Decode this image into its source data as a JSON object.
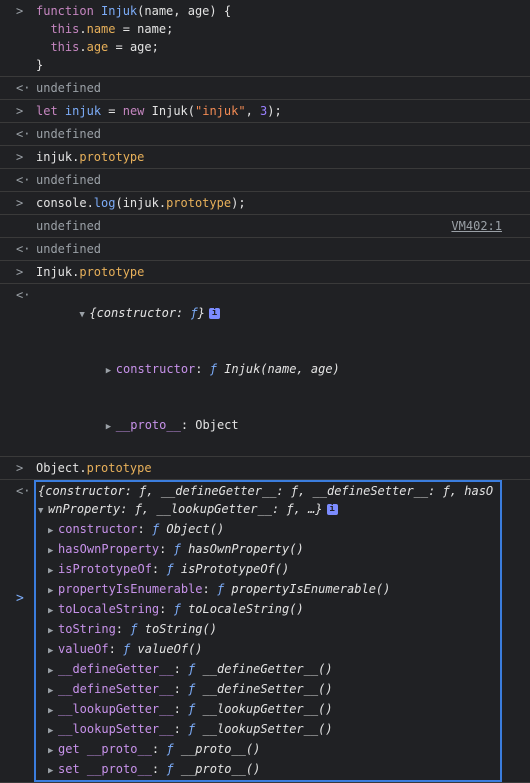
{
  "entries": [
    {
      "kind": "input",
      "lines": [
        "function Injuk(name, age) {",
        "  this.name = name;",
        "  this.age = age;",
        "}"
      ]
    },
    {
      "kind": "result",
      "text": "undefined"
    },
    {
      "kind": "input",
      "text": "let injuk = new Injuk(\"injuk\", 3);"
    },
    {
      "kind": "result",
      "text": "undefined"
    },
    {
      "kind": "input",
      "text": "injuk.prototype"
    },
    {
      "kind": "result",
      "text": "undefined"
    },
    {
      "kind": "input",
      "text": "console.log(injuk.prototype);"
    },
    {
      "kind": "log",
      "text": "undefined",
      "link": "VM402:1"
    },
    {
      "kind": "result",
      "text": "undefined"
    },
    {
      "kind": "input",
      "text": "Injuk.prototype"
    }
  ],
  "injuk_proto": {
    "summary_a": "{constructor: ",
    "summary_f": "ƒ",
    "summary_b": "}",
    "rows": [
      {
        "key": "constructor",
        "sep": ": ",
        "f": "ƒ ",
        "value": "Injuk(name, age)"
      },
      {
        "key": "__proto__",
        "sep": ": ",
        "f": "",
        "value": "Object"
      }
    ]
  },
  "object_input": "Object.prototype",
  "object_proto": {
    "summary_l1": "{constructor: ƒ, __defineGetter__: ƒ, __defineSetter__: ƒ, hasO",
    "summary_l2": "wnProperty: ƒ, __lookupGetter__: ƒ, …}",
    "rows": [
      {
        "key": "constructor",
        "value": "Object()"
      },
      {
        "key": "hasOwnProperty",
        "value": "hasOwnProperty()"
      },
      {
        "key": "isPrototypeOf",
        "value": "isPrototypeOf()"
      },
      {
        "key": "propertyIsEnumerable",
        "value": "propertyIsEnumerable()"
      },
      {
        "key": "toLocaleString",
        "value": "toLocaleString()"
      },
      {
        "key": "toString",
        "value": "toString()"
      },
      {
        "key": "valueOf",
        "value": "valueOf()"
      },
      {
        "key": "__defineGetter__",
        "value": "__defineGetter__()"
      },
      {
        "key": "__defineSetter__",
        "value": "__defineSetter__()"
      },
      {
        "key": "__lookupGetter__",
        "value": "__lookupGetter__()"
      },
      {
        "key": "__lookupSetter__",
        "value": "__lookupSetter__()"
      },
      {
        "key": "get __proto__",
        "value": "__proto__()"
      },
      {
        "key": "set __proto__",
        "value": "__proto__()"
      }
    ]
  },
  "prompt_symbol": ">",
  "input_marker": ">",
  "result_marker": "<·",
  "info_badge": "i",
  "func_symbol": "ƒ"
}
